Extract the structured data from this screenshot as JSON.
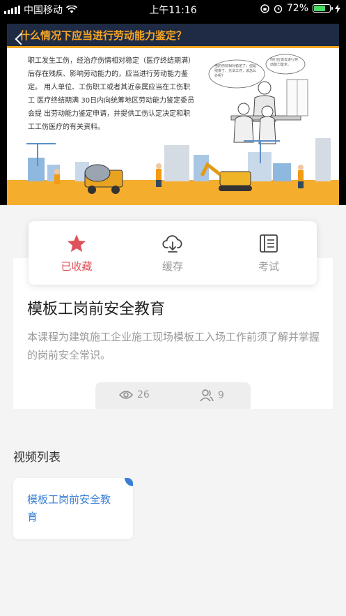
{
  "status_bar": {
    "carrier": "中国移动",
    "time": "上午11:16",
    "battery": "72%",
    "battery_level": 0.72
  },
  "video": {
    "slide_title": "什么情况下应当进行劳动能力鉴定？",
    "slide_text": "职工发生工伤，经治疗伤情相对稳定（医疗终结期满）后存在残疾、影响劳动能力的，应当进行劳动能力鉴定。 用人单位、工伤职工或者其近亲属应当在工伤职工 医疗终结期满 30日内向统筹地区劳动能力鉴定委员会提 出劳动能力鉴定申请，并提供工伤认定决定和职工工伤医疗的有关资料。",
    "bubble_left": "他的伤情相对稳定了，但是残疾了，无法工作，该怎么办呢？",
    "bubble_right": "你们应该去进行劳动能力鉴定。"
  },
  "actions": [
    {
      "label": "已收藏",
      "icon": "star-icon",
      "active": true
    },
    {
      "label": "缓存",
      "icon": "cloud-download-icon",
      "active": false
    },
    {
      "label": "考试",
      "icon": "exam-book-icon",
      "active": false
    }
  ],
  "course": {
    "title": "模板工岗前安全教育",
    "description": "本课程为建筑施工企业施工现场模板工入场工作前须了解并掌握的岗前安全常识。",
    "views": "26",
    "learners": "9"
  },
  "video_list": {
    "title": "视频列表",
    "items": [
      {
        "name": "模板工岗前安全教育"
      }
    ]
  },
  "colors": {
    "accent_red": "#e0525b",
    "link_blue": "#3a7fd5",
    "slide_orange": "#f5a623",
    "slide_navy": "#1f2b44"
  }
}
